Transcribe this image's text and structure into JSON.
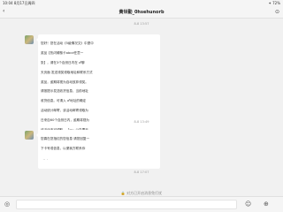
{
  "status_bar": {
    "time": "10:04",
    "date": "8月17日周四",
    "right_info": "✦ 72%"
  },
  "nav": {
    "back_label": "‹",
    "title": "黄世勤_0hsehunorb",
    "settings_icon": "⊙"
  },
  "timestamps": [
    "8-8 13:57",
    "8-8 13:49",
    "8-8 17:07"
  ],
  "messages": [
    {
      "text_lines": [
        "您好！您在活动《5級情况文》中提中",
        "奖品【热闪硬核卡abcd任意一",
        "张】，请在3个自然日内在 ♂聊",
        "天页面 发送领奖领取地址和联系方式",
        "奖品，逾期将视为自动放弃领奖。",
        "请按提示发送收货信息，当前地址",
        "收货信息。可请入 ♂地址的确定",
        "活动统计邮寄，该活动邮寄领取为",
        "日来自60个自然日内，逾期将视为",
        "该活动不可领取。「一」公告要无",
        "帮助您领取奖品，请您于24小时",
        "请在我方系统指引完成兑奖，谢谢",
        "（！）"
      ]
    },
    {
      "text_lines": [
        "您喜在您指红的您信息 请您回复一",
        "下卡号或信息，以便我方联系你"
      ]
    }
  ],
  "lock_hint": "🔒 对方已开启消息免打扰",
  "input_bar": {
    "voice_icon": "◎",
    "emoji_icon": "☺",
    "plus_icon": "⊕"
  }
}
